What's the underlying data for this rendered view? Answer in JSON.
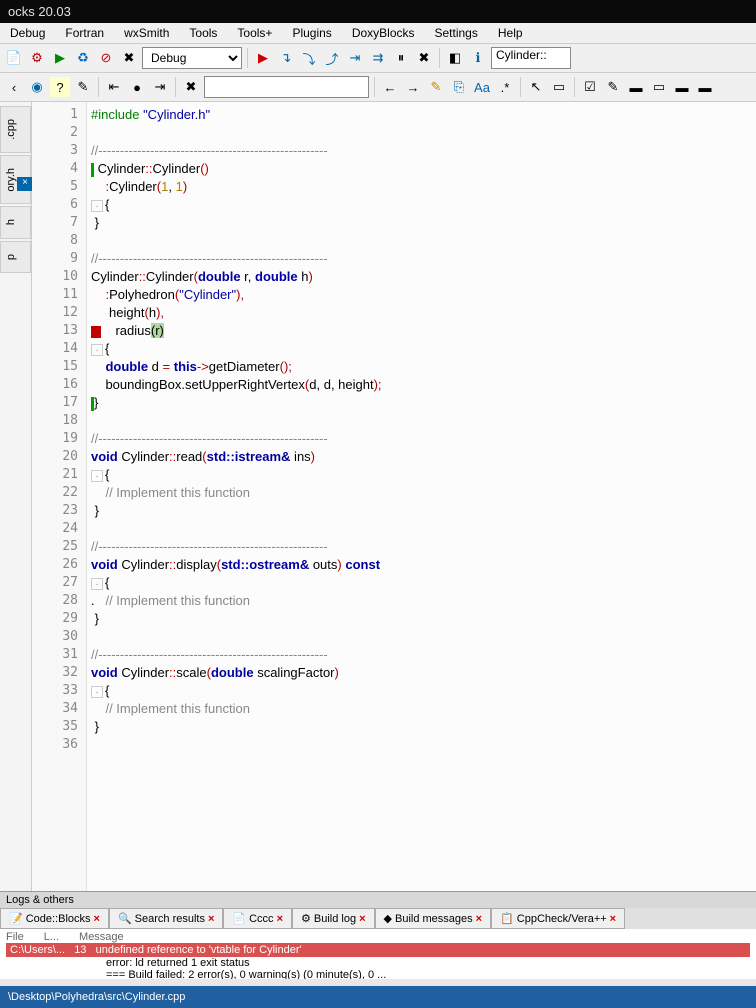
{
  "title": "ocks 20.03",
  "menu": [
    "Debug",
    "Fortran",
    "wxSmith",
    "Tools",
    "Tools+",
    "Plugins",
    "DoxyBlocks",
    "Settings",
    "Help"
  ],
  "toolbar1": {
    "build_target": "Debug",
    "right_label": "Cylinder::"
  },
  "left_tabs": [
    ".cpp",
    "ory.h",
    "h",
    "p"
  ],
  "code_lines": [
    {
      "n": 1,
      "html": "<span class='inc'>#include</span> <span class='str'>\"Cylinder.h\"</span>"
    },
    {
      "n": 2,
      "html": ""
    },
    {
      "n": 3,
      "html": "<span class='cmt'>//-----------------------------------------------------</span>"
    },
    {
      "n": 4,
      "html": "<span class='green-bar'></span> Cylinder<span class='op'>::</span>Cylinder<span class='op'>()</span>"
    },
    {
      "n": 5,
      "html": "    <span class='op'>:</span>Cylinder<span class='op'>(</span><span class='num'>1</span>, <span class='num'>1</span><span class='op'>)</span>"
    },
    {
      "n": 6,
      "html": "<span class='fold'>-</span>{"
    },
    {
      "n": 7,
      "html": " }"
    },
    {
      "n": 8,
      "html": ""
    },
    {
      "n": 9,
      "html": "<span class='cmt'>//-----------------------------------------------------</span>"
    },
    {
      "n": 10,
      "html": "Cylinder<span class='op'>::</span>Cylinder<span class='op'>(</span><span class='kw'>double</span> r, <span class='kw'>double</span> h<span class='op'>)</span>"
    },
    {
      "n": 11,
      "html": "    <span class='op'>:</span>Polyhedron<span class='op'>(</span><span class='str'>\"Cylinder\"</span><span class='op'>),</span>"
    },
    {
      "n": 12,
      "html": "     height<span class='op'>(</span>h<span class='op'>),</span>"
    },
    {
      "n": 13,
      "html": "<span class='red-marker'></span>    radius<span class='hl'>(r)</span>"
    },
    {
      "n": 14,
      "html": "<span class='fold'>-</span>{"
    },
    {
      "n": 15,
      "html": "    <span class='kw'>double</span> d <span class='op'>=</span> <span class='kw'>this</span><span class='op'>-&gt;</span>getDiameter<span class='op'>();</span>"
    },
    {
      "n": 16,
      "html": "    boundingBox.setUpperRightVertex<span class='op'>(</span>d, d, height<span class='op'>);</span>"
    },
    {
      "n": 17,
      "html": "<span class='green-bar'></span>}"
    },
    {
      "n": 18,
      "html": ""
    },
    {
      "n": 19,
      "html": "<span class='cmt'>//-----------------------------------------------------</span>"
    },
    {
      "n": 20,
      "html": "<span class='kw'>void</span> Cylinder<span class='op'>::</span>read<span class='op'>(</span><span class='kw'>std::istream&amp;</span> ins<span class='op'>)</span>"
    },
    {
      "n": 21,
      "html": "<span class='fold'>-</span>{"
    },
    {
      "n": 22,
      "html": "    <span class='cmt'>// Implement this function</span>"
    },
    {
      "n": 23,
      "html": " }"
    },
    {
      "n": 24,
      "html": ""
    },
    {
      "n": 25,
      "html": "<span class='cmt'>//-----------------------------------------------------</span>"
    },
    {
      "n": 26,
      "html": "<span class='kw'>void</span> Cylinder<span class='op'>::</span>display<span class='op'>(</span><span class='kw'>std::ostream&amp;</span> outs<span class='op'>)</span> <span class='kw'>const</span>"
    },
    {
      "n": 27,
      "html": "<span class='fold'>-</span>{"
    },
    {
      "n": 28,
      "html": ".   <span class='cmt'>// Implement this function</span>"
    },
    {
      "n": 29,
      "html": " }"
    },
    {
      "n": 30,
      "html": ""
    },
    {
      "n": 31,
      "html": "<span class='cmt'>//-----------------------------------------------------</span>"
    },
    {
      "n": 32,
      "html": "<span class='kw'>void</span> Cylinder<span class='op'>::</span>scale<span class='op'>(</span><span class='kw'>double</span> scalingFactor<span class='op'>)</span>"
    },
    {
      "n": 33,
      "html": "<span class='fold'>-</span>{"
    },
    {
      "n": 34,
      "html": "    <span class='cmt'>// Implement this function</span>"
    },
    {
      "n": 35,
      "html": " }"
    },
    {
      "n": 36,
      "html": ""
    }
  ],
  "logs": {
    "header": "Logs & others",
    "tabs": [
      "Code::Blocks",
      "Search results",
      "Cccc",
      "Build log",
      "Build messages",
      "CppCheck/Vera++"
    ],
    "col_headers": [
      "File",
      "L...",
      "Message"
    ],
    "row_file": "C:\\Users\\...",
    "row_line": "13",
    "row_msg": "undefined reference to 'vtable for Cylinder'",
    "msg2": "error: ld returned 1 exit status",
    "msg3": "=== Build failed: 2 error(s), 0 warning(s) (0 minute(s), 0 ..."
  },
  "status": "\\Desktop\\Polyhedra\\src\\Cylinder.cpp"
}
